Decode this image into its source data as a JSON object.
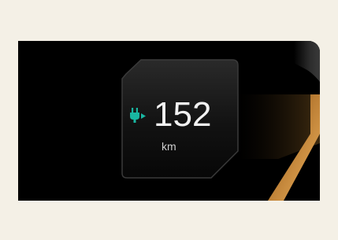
{
  "range_display": {
    "value": "152",
    "unit": "km",
    "charging_icon": "ev-plug-charging-icon"
  },
  "colors": {
    "page_background": "#f4f0e6",
    "screen_background": "#000000",
    "icon_accent": "#19b7a2",
    "text_primary": "#f1f1f1",
    "amber_accent": "#c98a38"
  }
}
